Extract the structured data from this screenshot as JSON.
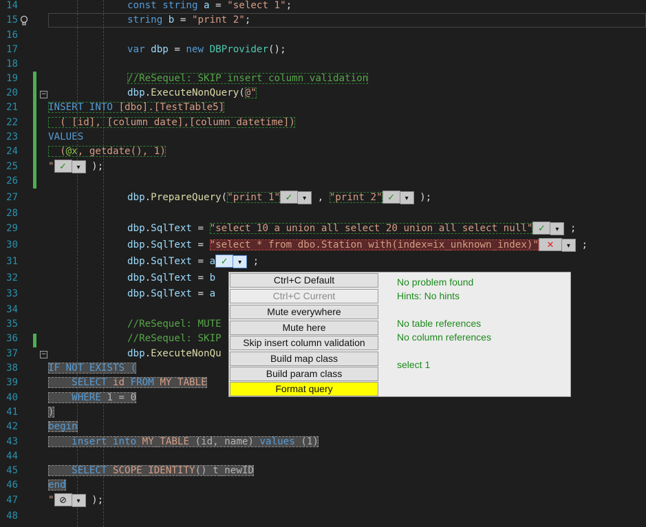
{
  "line_numbers": [
    "14",
    "15",
    "16",
    "17",
    "18",
    "19",
    "20",
    "21",
    "22",
    "23",
    "24",
    "25",
    "26",
    "27",
    "28",
    "29",
    "30",
    "31",
    "32",
    "33",
    "34",
    "35",
    "36",
    "37",
    "38",
    "39",
    "40",
    "41",
    "42",
    "43",
    "44",
    "45",
    "46",
    "47",
    "48"
  ],
  "code": {
    "l14": {
      "t1": "const ",
      "t2": "string ",
      "t3": "a",
      "t4": " = ",
      "t5": "\"select 1\"",
      "t6": ";"
    },
    "l15": {
      "t1": "string ",
      "t2": "b",
      "t3": " = ",
      "t4": "\"print 2\"",
      "t5": ";"
    },
    "l17": {
      "t1": "var ",
      "t2": "dbp",
      "t3": " = ",
      "t4": "new ",
      "t5": "DBProvider",
      "t6": "();"
    },
    "l19": {
      "t1": "//ReSequel: SKIP insert column validation"
    },
    "l20": {
      "t1": "dbp",
      "t2": ".",
      "t3": "ExecuteNonQuery",
      "t4": "(",
      "t5": "@\""
    },
    "l21": {
      "t1": "INSERT INTO ",
      "t2": "[dbo].[TestTable5]"
    },
    "l22": {
      "t1": "  ( ",
      "t2": "[id]",
      "t3": ", ",
      "t4": "[column_date]",
      "t5": ",",
      "t6": "[column_datetime]",
      "t7": ")"
    },
    "l23": {
      "t1": "VALUES"
    },
    "l24": {
      "t1": "  (",
      "t2": "@x",
      "t3": ", ",
      "t4": "getdate",
      "t5": "(), ",
      "t6": "1",
      "t7": ")"
    },
    "l25": {
      "t1": "\"",
      "t2": " );"
    },
    "l27": {
      "t1": "dbp",
      "t2": ".",
      "t3": "PrepareQuery",
      "t4": "(",
      "t5": "\"print 1\"",
      "t6": " , ",
      "t7": "\"print 2\"",
      "t8": " );"
    },
    "l29": {
      "t1": "dbp",
      "t2": ".",
      "t3": "SqlText",
      "t4": " = ",
      "t5": "\"select 10 a union all select 20 union all select null\"",
      "t6": " ;"
    },
    "l30": {
      "t1": "dbp",
      "t2": ".",
      "t3": "SqlText",
      "t4": " = ",
      "t5": "\"select * from dbo.Station with(index=ix_unknown_index)\"",
      "t6": " ;"
    },
    "l31": {
      "t1": "dbp",
      "t2": ".",
      "t3": "SqlText",
      "t4": " = ",
      "t5": "a",
      "t6": " ;"
    },
    "l32": {
      "t1": "dbp",
      "t2": ".",
      "t3": "SqlText",
      "t4": " = ",
      "t5": "b"
    },
    "l33": {
      "t1": "dbp",
      "t2": ".",
      "t3": "SqlText",
      "t4": " = ",
      "t5": "a"
    },
    "l35": {
      "t1": "//ReSequel: MUTE"
    },
    "l36": {
      "t1": "//ReSequel: SKIP"
    },
    "l37": {
      "t1": "dbp",
      "t2": ".",
      "t3": "ExecuteNonQu"
    },
    "l38": {
      "t1": "IF NOT EXISTS ("
    },
    "l39": {
      "t1": "    SELECT ",
      "t2": "id ",
      "t3": "FROM ",
      "t4": "MY_TABLE"
    },
    "l40": {
      "t1": "    WHERE ",
      "t2": "1 ",
      "t3": "= ",
      "t4": "0"
    },
    "l41": {
      "t1": ")"
    },
    "l42": {
      "t1": "begin"
    },
    "l43": {
      "t1": "    insert into ",
      "t2": "MY_TABLE ",
      "t3": "(id, name) ",
      "t4": "values ",
      "t5": "(1)"
    },
    "l45": {
      "t1": "    SELECT ",
      "t2": "SCOPE_IDENTITY",
      "t3": "() t_newID"
    },
    "l46": {
      "t1": "end"
    },
    "l47": {
      "t1": "\"",
      "t2": " );"
    }
  },
  "widgets": {
    "ok": "✓",
    "bad": "✕",
    "mute": "⊘",
    "dropdown": "▾"
  },
  "popup": {
    "menu": [
      {
        "label": "Ctrl+C Default",
        "enabled": true
      },
      {
        "label": "Ctrl+C Current",
        "enabled": false
      },
      {
        "label": "Mute everywhere",
        "enabled": true
      },
      {
        "label": "Mute here",
        "enabled": true
      },
      {
        "label": "Skip insert column validation",
        "enabled": true
      },
      {
        "label": "Build map class",
        "enabled": true
      },
      {
        "label": "Build param class",
        "enabled": true
      },
      {
        "label": "Format query",
        "enabled": true,
        "highlighted": true
      }
    ],
    "info": {
      "status": "No problem found",
      "hints": "Hints: No hints",
      "tables": "No table references",
      "columns": "No column references",
      "query": "select 1"
    }
  },
  "colors": {
    "background": "#1e1e1e",
    "keyword": "#569cd6",
    "string": "#d69d85",
    "comment": "#57a64a",
    "type": "#4ec9b0",
    "highlight": "#ffff00"
  }
}
